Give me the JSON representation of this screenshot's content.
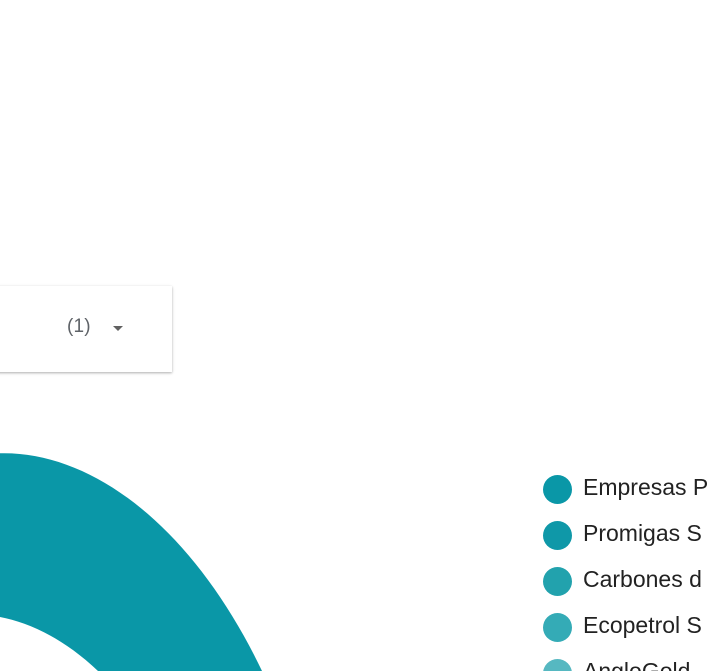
{
  "filter": {
    "selected_value": "(1)",
    "caret_icon": "arrow-drop-down-icon"
  },
  "chart_data": {
    "type": "pie",
    "title": "",
    "labels": [
      "Empresas P",
      "Promigas S",
      "Carbones d",
      "Ecopetrol S",
      "AngloGold"
    ],
    "colors": [
      "#0a97a7",
      "#0f98a8",
      "#22a2ad",
      "#34abb6",
      "#56b8c1"
    ]
  }
}
